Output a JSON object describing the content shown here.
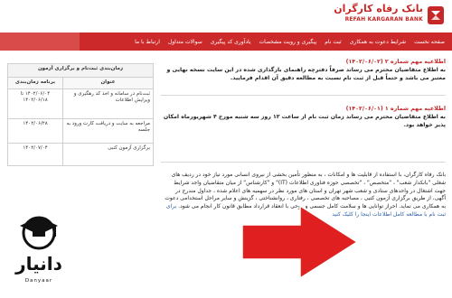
{
  "header": {
    "bank_name_fa": "بانک رفاه کارگران",
    "bank_name_en": "REFAH KARGARAN BANK"
  },
  "nav": {
    "items": [
      "صفحه نخست",
      "شرایط دعوت به همکاری",
      "ثبت نام",
      "پیگیری و رویت مشخصات",
      "یادآوری کد پیگیری",
      "سوالات متداول",
      "ارتباط با ما"
    ]
  },
  "announcements": [
    {
      "title": "اطلاعیه مهم شماره ۲ (۱۴۰۲/۰۶/۰۲)",
      "body": "به اطلاع متقاضیان محترم می رساند صرفاً دفترچه راهنمای بارگذاری شده در این سایت نسخه نهایی و معتبر می باشد و حتماً قبل از ثبت نام نسبت به مطالعه دقیق آن اقدام فرمایید."
    },
    {
      "title": "اطلاعیه مهم شماره ۱ (۱۴۰۲/۰۶/۰۱)",
      "body": "به اطلاع متقاضیان محترم می رساند زمان ثبت نام از ساعت ۱۲ روز سه شنبه مورخ ۴ شهریورماه امکان پذیر خواهد بود."
    }
  ],
  "intro": {
    "text": "بانک رفاه کارگران، با استفاده از قابلیت ها و امکانات ، به منظور تأمین بخشی از نیروی انسانی مورد نیاز خود در ردیف های شغلی \"بانکدار شعب\" ، \"متخصص\" ، \"تخصصی حوزه فناوری اطلاعات (IT)\" و \"کارشناس\" از میان متقاضیان واجد شرایط جهت اشتغال در واحدهای ستادی و شعب شهر تهران و استان های مورد نظر در سهمیه های اعلام شده ، جداول مندرج در آگهی، از طریق برگزاری آزمون کتبی ، مصاحبه های تخصصی ، رفتاری ، روانشناختی ، گزینش و سایر مراحل استخدامی دعوت به همکاری می نماید. احراز توانایی ها و سلامت کامل جسمی و روحی با انعقاد قرارداد مطابق قانون کار انجام می شود.",
    "link_text": "برای ثبت نام با مطالعه کامل اطلاعات اینجا را کلیک کنید"
  },
  "schedule": {
    "caption": "زمان‌بندی ثبت‌نام و برگزاری آزمون",
    "headers": [
      "عنوان",
      "برنامه زمان‌بندی"
    ],
    "rows": [
      {
        "title": "ثبت‌نام در سامانه و اخذ کد رهگیری و ویرایش اطلاعات",
        "date": "۱۴۰۲/۰۶/۰۴ تا ۱۴۰۲/۰۶/۱۸"
      },
      {
        "title": "مراجعه به سایت و دریافت کارت ورود به جلسه",
        "date": "۱۴۰۲/۰۶/۲۸"
      },
      {
        "title": "برگزاری آزمون کتبی",
        "date": "۱۴۰۲/۰۷/۰۴"
      }
    ]
  },
  "watermark": {
    "brand_fa": "دانیار",
    "brand_en": "Danyaar"
  },
  "colors": {
    "brand_red": "#c62828",
    "nav_red": "#cc2a2a",
    "arrow_red": "#e02020",
    "link_blue": "#2b5fa8"
  },
  "icons": {
    "bank_logo": "refah-bank-logo-icon",
    "watermark": "graduation-cap-icon",
    "arrow": "red-pointer-arrow"
  }
}
